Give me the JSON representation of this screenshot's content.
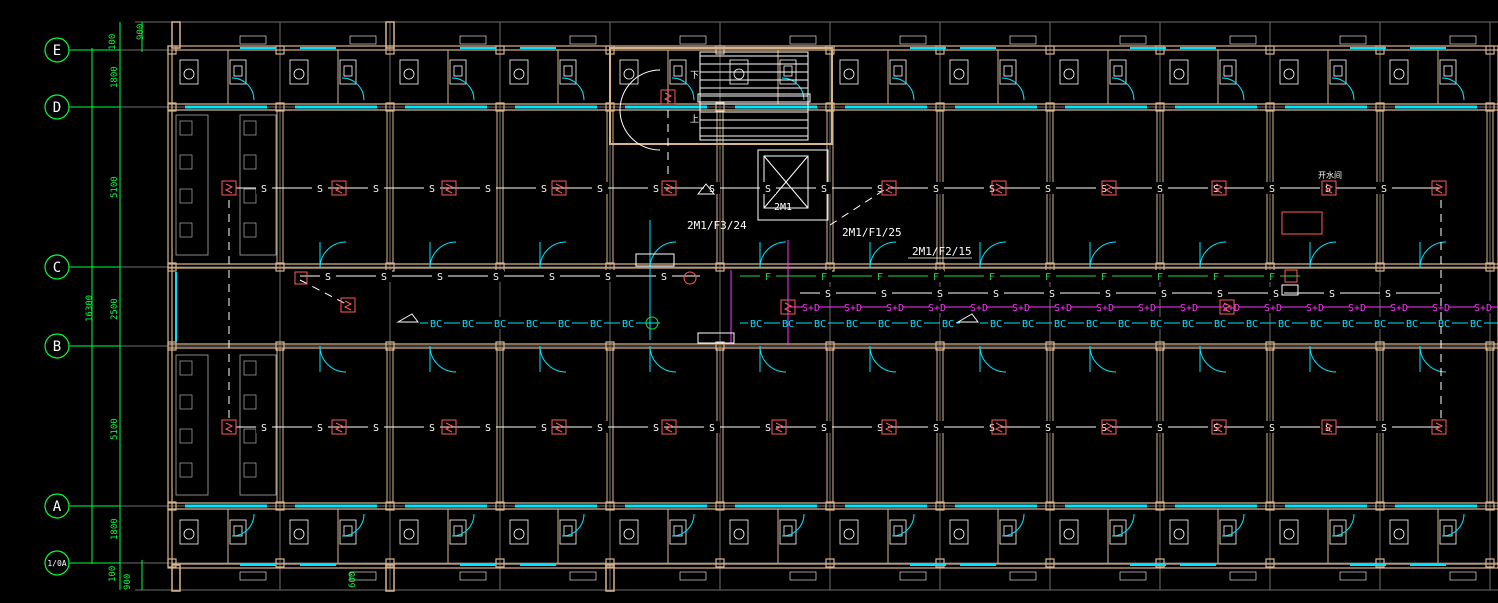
{
  "drawing": {
    "grid_bubbles": [
      {
        "id": "E",
        "label": "E"
      },
      {
        "id": "D",
        "label": "D"
      },
      {
        "id": "C",
        "label": "C"
      },
      {
        "id": "B",
        "label": "B"
      },
      {
        "id": "A",
        "label": "A"
      },
      {
        "id": "1A",
        "label": "1/0A"
      }
    ],
    "dimensions": {
      "top_900": "900",
      "top_100": "100",
      "span_ED": "1800",
      "span_DC": "5100",
      "span_CB": "2500",
      "span_BA": "5100",
      "span_A1A": "1800",
      "bottom_100": "100",
      "bottom_900": "900",
      "bottom_600": "600",
      "total": "16300"
    },
    "annotations": {
      "feeder_1": "2M1/F3/24",
      "feeder_2": "2M1/F1/25",
      "feeder_3": "2M1/F2/15",
      "elevator": "2M1",
      "water_room": "开水间",
      "stair_down": "下",
      "stair_up": "上"
    },
    "line_labels": {
      "smoke": "S",
      "fire": "F",
      "broadcast": "BC",
      "smoke_plus": "S+D"
    },
    "colors": {
      "wall": "#d8b48a",
      "grid_green": "#00ff3c",
      "axis_grey": "#7a7a7a",
      "cyan": "#00e5ff",
      "magenta": "#ff30ff",
      "device_red": "#ff5a5a",
      "white": "#ffffff",
      "fire_line": "#27d63c"
    }
  }
}
